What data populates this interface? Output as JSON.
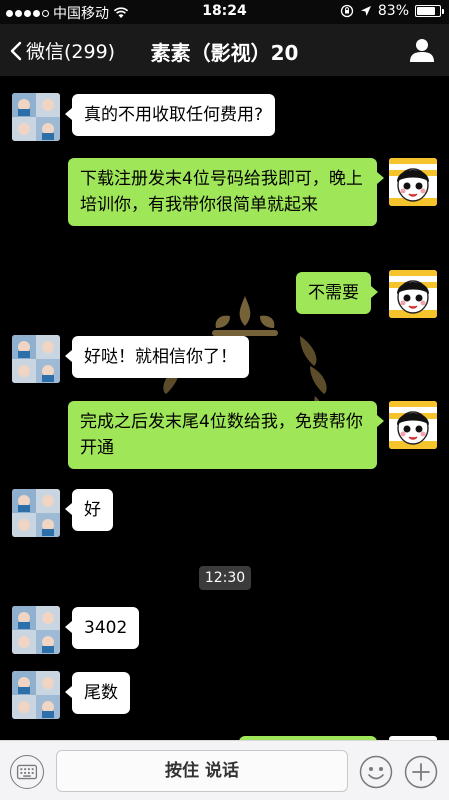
{
  "status_bar": {
    "carrier": "中国移动",
    "time": "18:24",
    "battery": "83%",
    "battery_level": 0.83,
    "icons": [
      "signal-dots-icon",
      "wifi-icon",
      "orientation-lock-icon",
      "location-arrow-icon",
      "battery-icon"
    ]
  },
  "nav": {
    "back_label": "微信(299)",
    "title": "素素（影视）20"
  },
  "chat": {
    "timestamp": "12:30",
    "messages": [
      {
        "side": "in",
        "text": "真的不用收取任何费用?"
      },
      {
        "side": "out",
        "text": "下载注册发末4位号码给我即可，晚上培训你，有我带你很简单就起来"
      },
      {
        "side": "out",
        "text": "不需要"
      },
      {
        "side": "in",
        "text": "好哒！就相信你了！"
      },
      {
        "side": "out",
        "text": "完成之后发末尾4位数给我，免费帮你开通"
      },
      {
        "side": "in",
        "text": "好"
      },
      {
        "side": "in",
        "text": "3402"
      },
      {
        "side": "in",
        "text": "尾数"
      }
    ]
  },
  "input_bar": {
    "hold_to_talk": "按住 说话"
  },
  "colors": {
    "outgoing_bubble": "#9fe658",
    "incoming_bubble": "#ffffff",
    "chat_background": "#000000",
    "nav_background": "#1a1a1a"
  }
}
